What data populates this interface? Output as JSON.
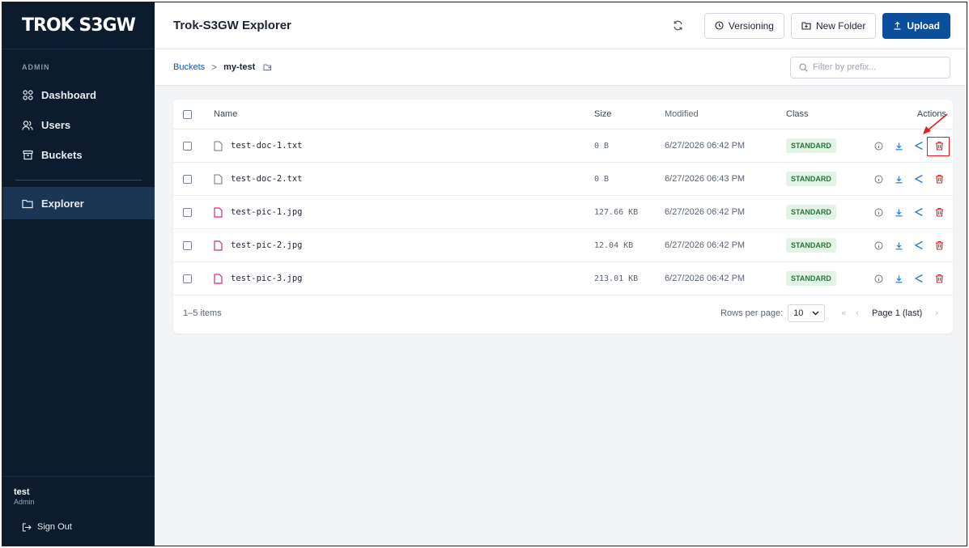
{
  "brand": "TROK S3GW",
  "sidebar": {
    "section_label": "ADMIN",
    "items": [
      {
        "label": "Dashboard",
        "icon": "grid-icon"
      },
      {
        "label": "Users",
        "icon": "users-icon"
      },
      {
        "label": "Buckets",
        "icon": "bucket-icon"
      }
    ],
    "explorer": {
      "label": "Explorer",
      "icon": "folder-icon"
    },
    "user": {
      "name": "test",
      "role": "Admin"
    },
    "sign_out": "Sign Out"
  },
  "header": {
    "title": "Trok-S3GW Explorer",
    "versioning_label": "Versioning",
    "new_folder_label": "New Folder",
    "upload_label": "Upload"
  },
  "breadcrumb": {
    "root": "Buckets",
    "separator": ">",
    "current": "my-test"
  },
  "search": {
    "placeholder": "Filter by prefix..."
  },
  "table": {
    "columns": {
      "name": "Name",
      "size": "Size",
      "modified": "Modified",
      "class": "Class",
      "actions": "Actions"
    },
    "rows": [
      {
        "name": "test-doc-1.txt",
        "type": "doc",
        "size": "0 B",
        "modified": "6/27/2026 06:42 PM",
        "class": "STANDARD"
      },
      {
        "name": "test-doc-2.txt",
        "type": "doc",
        "size": "0 B",
        "modified": "6/27/2026 06:43 PM",
        "class": "STANDARD"
      },
      {
        "name": "test-pic-1.jpg",
        "type": "pic",
        "size": "127.66 KB",
        "modified": "6/27/2026 06:42 PM",
        "class": "STANDARD"
      },
      {
        "name": "test-pic-2.jpg",
        "type": "pic",
        "size": "12.04 KB",
        "modified": "6/27/2026 06:42 PM",
        "class": "STANDARD"
      },
      {
        "name": "test-pic-3.jpg",
        "type": "pic",
        "size": "213.01 KB",
        "modified": "6/27/2026 06:42 PM",
        "class": "STANDARD"
      }
    ],
    "item_count": "1–5 items",
    "rows_per_page_label": "Rows per page:",
    "rows_per_page_value": "10",
    "page_label": "Page 1 (last)"
  },
  "colors": {
    "sidebar_bg": "#0d1b2e",
    "accent": "#0b4f9a",
    "badge_green": "#1f7a33",
    "delete_red": "#e02020",
    "pic_icon": "#d6278a"
  }
}
